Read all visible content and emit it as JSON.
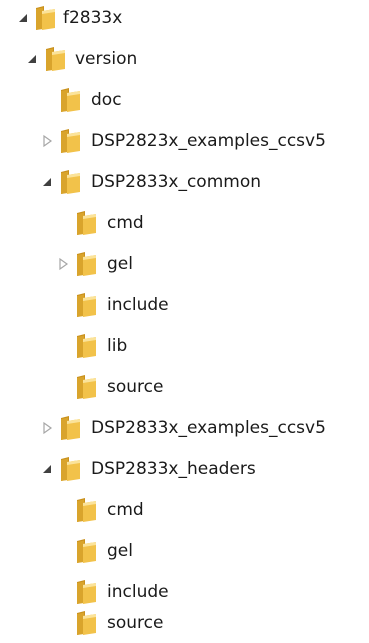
{
  "tree": {
    "items": [
      {
        "label": "f2833x",
        "state": "expanded"
      },
      {
        "label": "version",
        "state": "expanded"
      },
      {
        "label": "doc",
        "state": "leaf"
      },
      {
        "label": "DSP2823x_examples_ccsv5",
        "state": "collapsed"
      },
      {
        "label": "DSP2833x_common",
        "state": "expanded"
      },
      {
        "label": "cmd",
        "state": "leaf"
      },
      {
        "label": "gel",
        "state": "collapsed"
      },
      {
        "label": "include",
        "state": "leaf"
      },
      {
        "label": "lib",
        "state": "leaf"
      },
      {
        "label": "source",
        "state": "leaf"
      },
      {
        "label": "DSP2833x_examples_ccsv5",
        "state": "collapsed"
      },
      {
        "label": "DSP2833x_headers",
        "state": "expanded"
      },
      {
        "label": "cmd",
        "state": "leaf"
      },
      {
        "label": "gel",
        "state": "leaf"
      },
      {
        "label": "include",
        "state": "leaf"
      },
      {
        "label": "source",
        "state": "leaf"
      }
    ]
  },
  "colors": {
    "folder_front": "#f2c24a",
    "folder_back": "#d9a42c",
    "folder_tab": "#c9901c",
    "folder_highlight": "#fbe39a",
    "expanded_arrow": "#404040",
    "collapsed_arrow": "#a6a6a6"
  }
}
